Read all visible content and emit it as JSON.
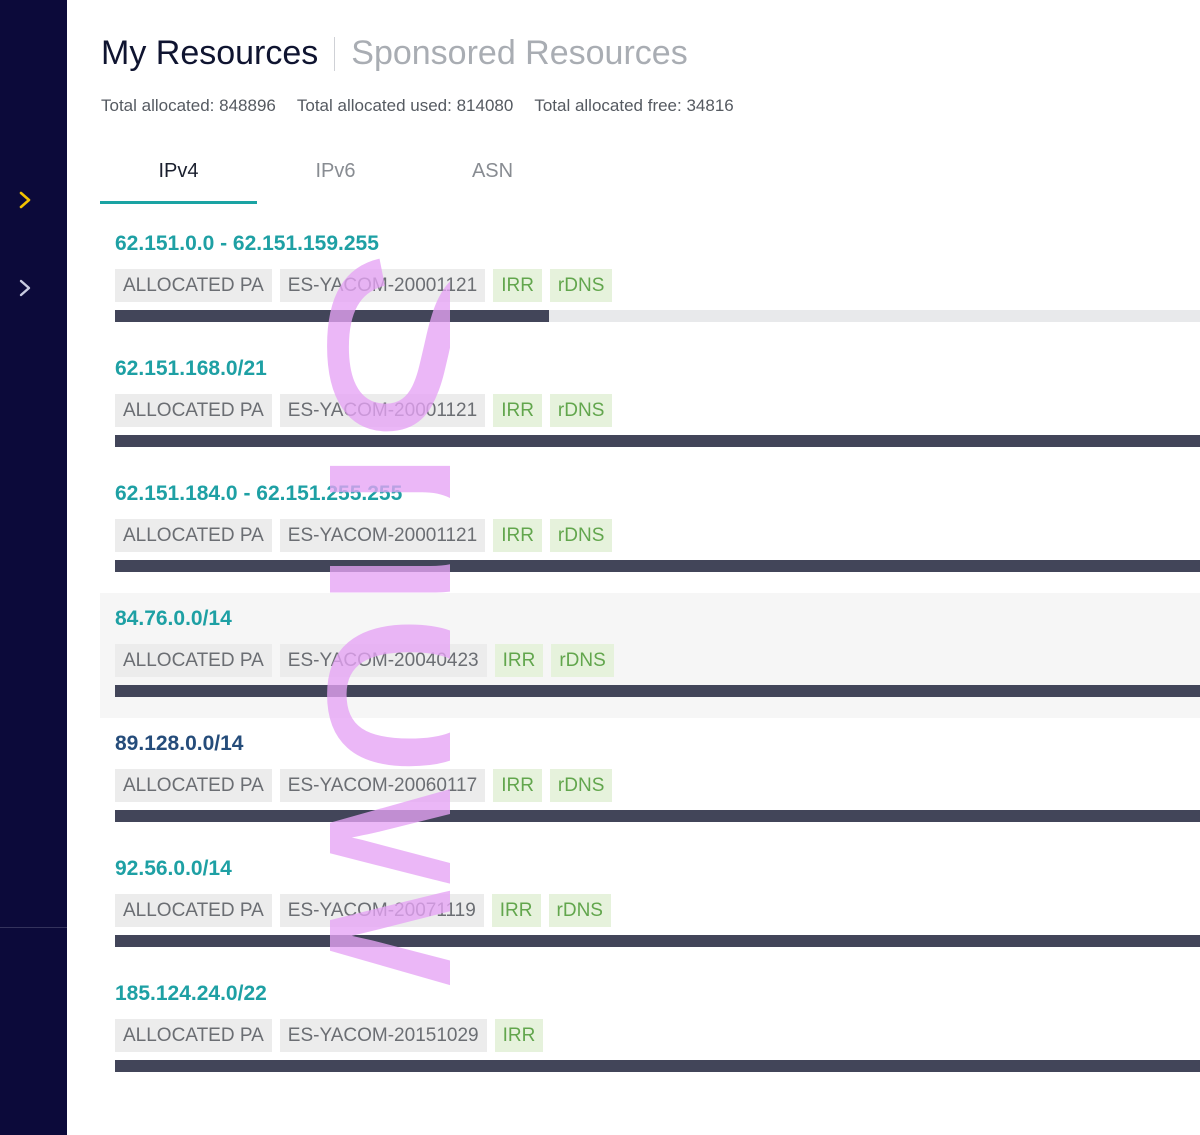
{
  "header": {
    "title": "My Resources",
    "secondary_title": "Sponsored Resources",
    "totals": {
      "allocated": "Total allocated: 848896",
      "used": "Total allocated used: 814080",
      "free": "Total allocated free: 34816"
    }
  },
  "tabs": [
    {
      "label": "IPv4",
      "active": true
    },
    {
      "label": "IPv6",
      "active": false
    },
    {
      "label": "ASN",
      "active": false
    }
  ],
  "resources": [
    {
      "range": "62.151.0.0 - 62.151.159.255",
      "status": "ALLOCATED PA",
      "org": "ES-YACOM-20001121",
      "irr": "IRR",
      "rdns": "rDNS",
      "usage": 0.4
    },
    {
      "range": "62.151.168.0/21",
      "status": "ALLOCATED PA",
      "org": "ES-YACOM-20001121",
      "irr": "IRR",
      "rdns": "rDNS",
      "usage": 1.0
    },
    {
      "range": "62.151.184.0 - 62.151.255.255",
      "status": "ALLOCATED PA",
      "org": "ES-YACOM-20001121",
      "irr": "IRR",
      "rdns": "rDNS",
      "usage": 1.0
    },
    {
      "range": "84.76.0.0/14",
      "status": "ALLOCATED PA",
      "org": "ES-YACOM-20040423",
      "irr": "IRR",
      "rdns": "rDNS",
      "usage": 1.0
    },
    {
      "range": "89.128.0.0/14",
      "status": "ALLOCATED PA",
      "org": "ES-YACOM-20060117",
      "irr": "IRR",
      "rdns": "rDNS",
      "usage": 1.0
    },
    {
      "range": "92.56.0.0/14",
      "status": "ALLOCATED PA",
      "org": "ES-YACOM-20071119",
      "irr": "IRR",
      "rdns": "rDNS",
      "usage": 1.0
    },
    {
      "range": "185.124.24.0/22",
      "status": "ALLOCATED PA",
      "org": "ES-YACOM-20151029",
      "irr": "IRR",
      "usage": 1.0
    }
  ],
  "watermark": "Snow",
  "colors": {
    "sidebar_bg": "#0c0a3a",
    "accent_teal": "#1ea0a4",
    "active_chevron": "#f2c200",
    "bar_fill": "#424559",
    "tag_green_text": "#62a64d",
    "watermark": "#e6a3f5"
  },
  "icons": {
    "sidebar_expand_active": "chevron-right-icon",
    "sidebar_expand": "chevron-right-icon"
  }
}
